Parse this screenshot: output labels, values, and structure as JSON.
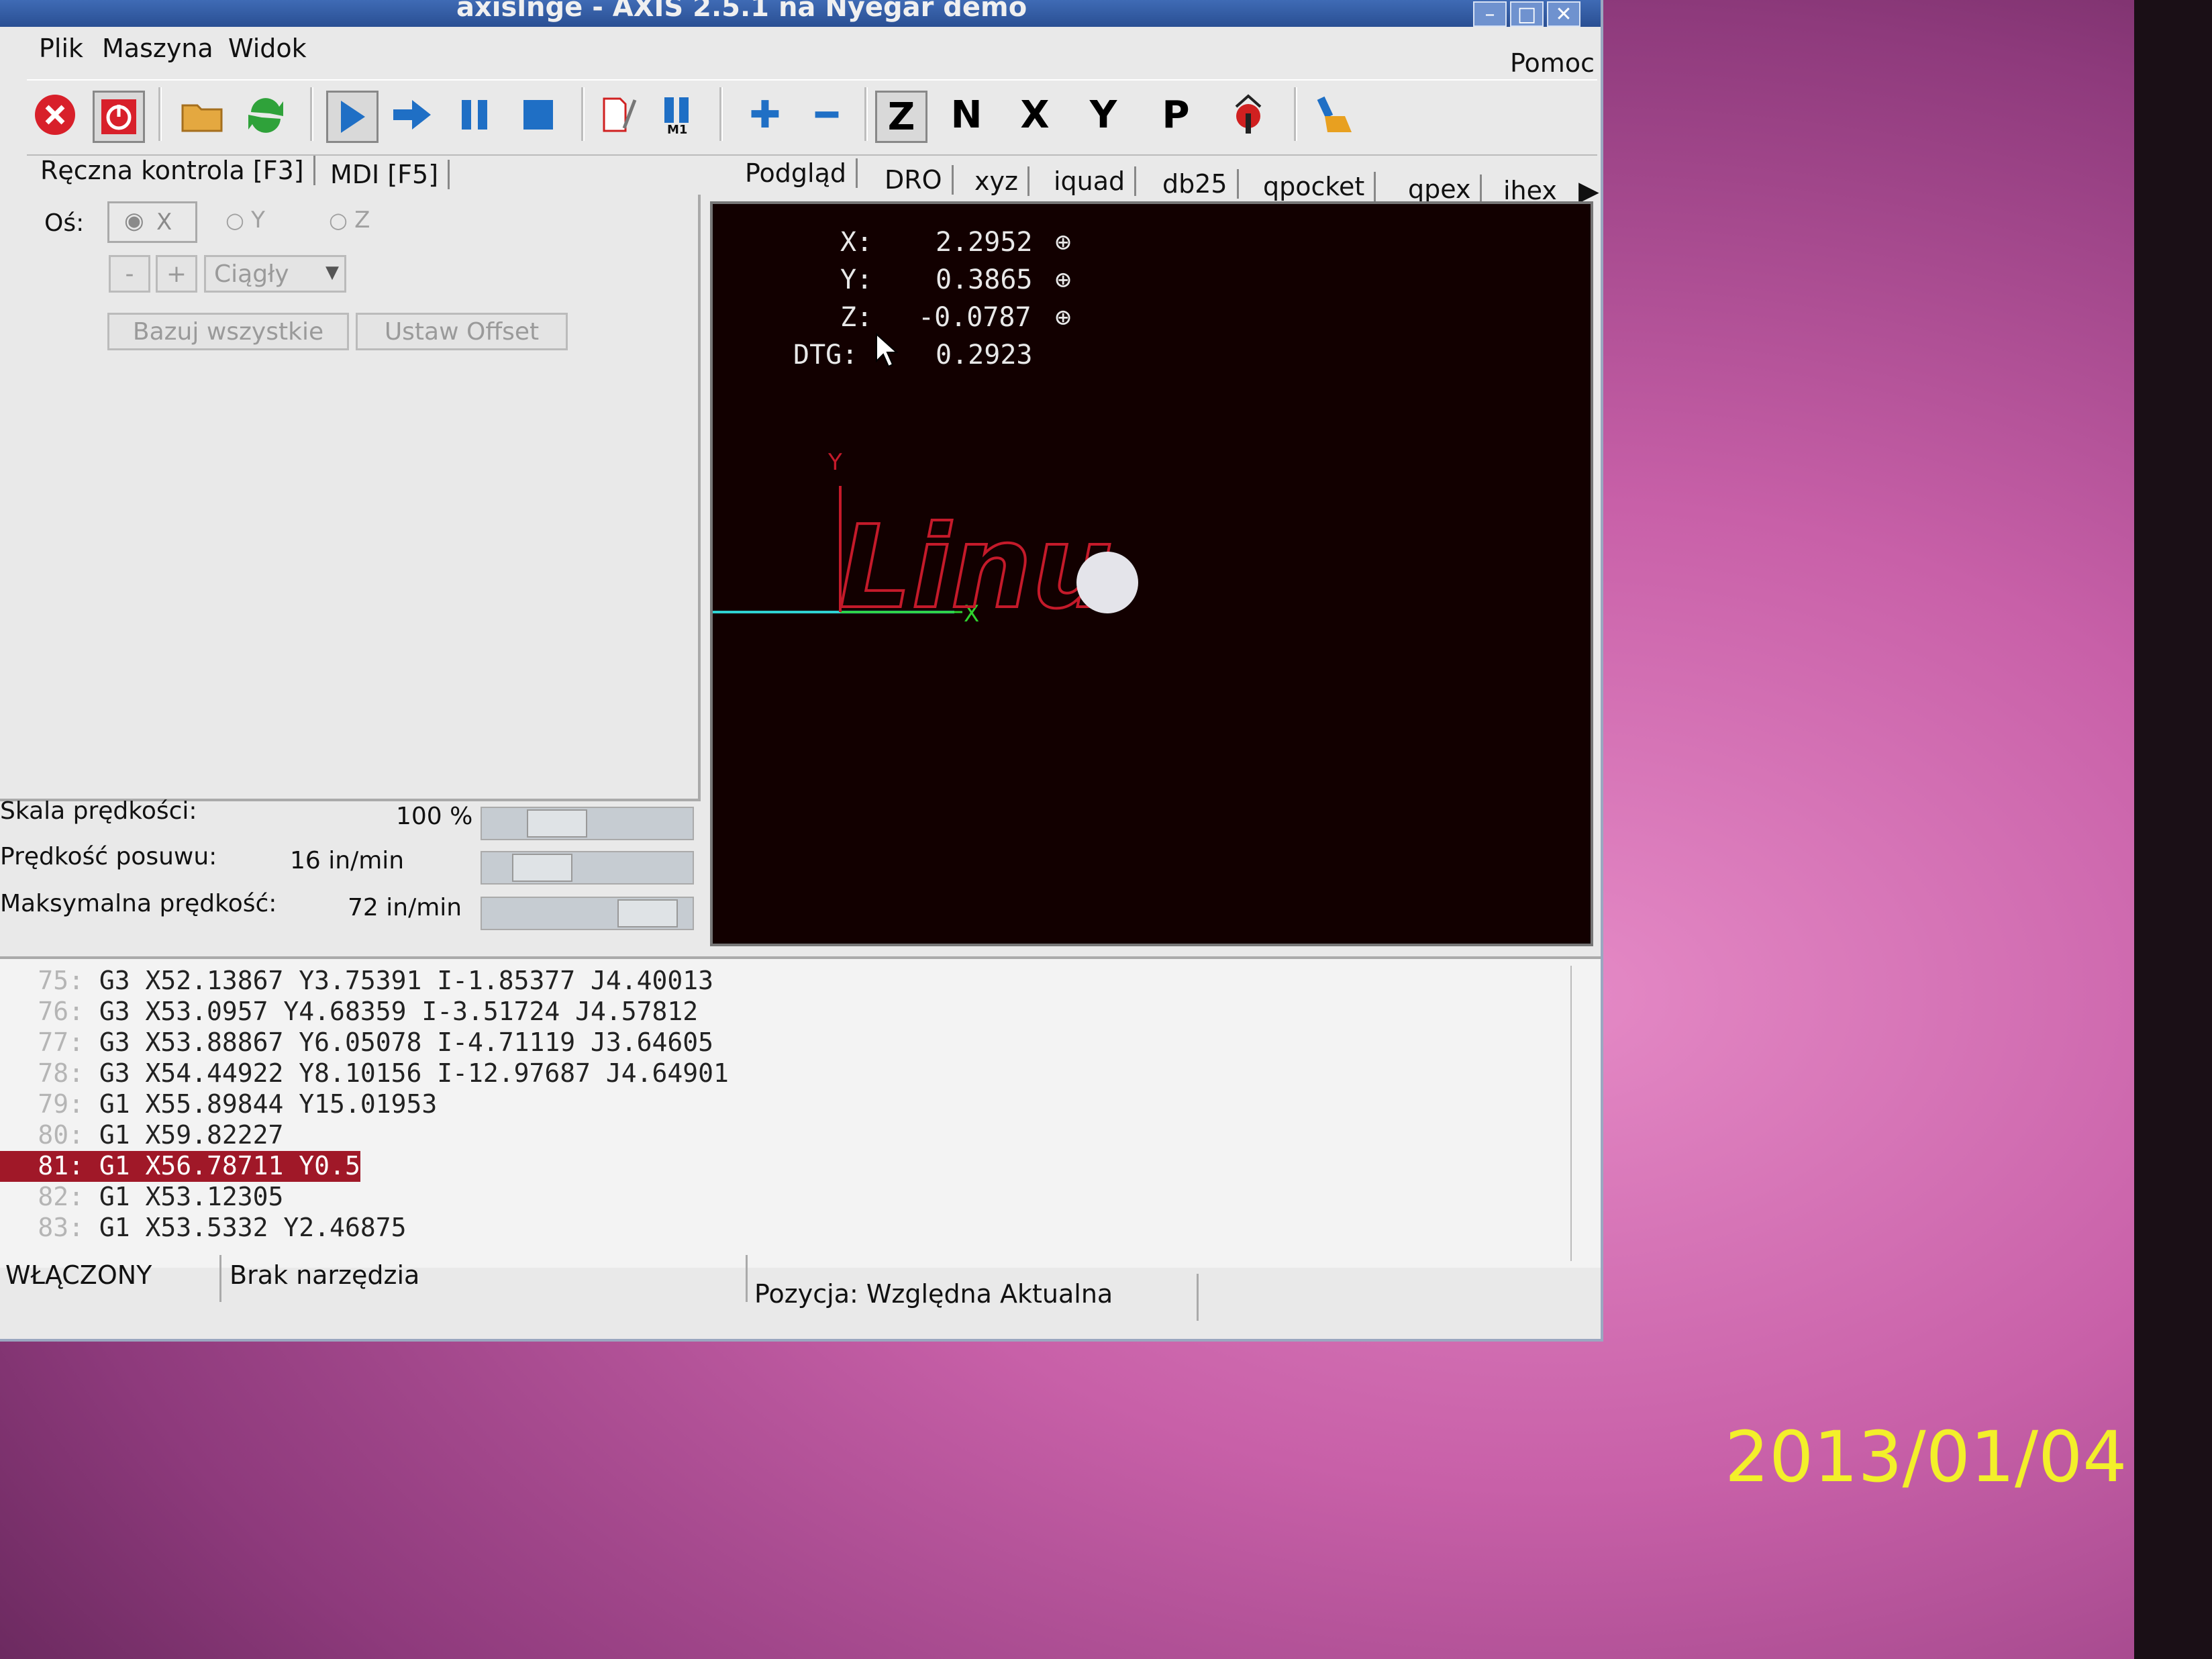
{
  "titlebar": {
    "title": "axislnge - AXIS 2.5.1 na Nyegar demo"
  },
  "menu": {
    "file": "Plik",
    "machine": "Maszyna",
    "view": "Widok",
    "help": "Pomoc"
  },
  "left_tabs": {
    "manual": "Ręczna kontrola [F3]",
    "mdi": "MDI [F5]"
  },
  "right_tabs": [
    "Podgląd",
    "DRO",
    "xyz",
    "iquad",
    "db25",
    "qpocket",
    "qpex",
    "ihex"
  ],
  "manual": {
    "axis_label": "Oś:",
    "axis_x": "X",
    "axis_y": "Y",
    "axis_z": "Z",
    "minus": "-",
    "plus": "+",
    "jog_mode": "Ciągły",
    "home_all": "Bazuj wszystkie",
    "set_offset": "Ustaw Offset"
  },
  "overrides": [
    {
      "label": "Skala prędkości:",
      "value": "100 %",
      "level": 0.3
    },
    {
      "label": "Prędkość posuwu:",
      "value": "16 in/min",
      "level": 0.2
    },
    {
      "label": "Maksymalna prędkość:",
      "value": "72 in/min",
      "level": 0.9
    }
  ],
  "dro": {
    "x_label": "X:",
    "x_value": "2.2952",
    "y_label": "Y:",
    "y_value": "0.3865",
    "z_label": "Z:",
    "z_value": "-0.0787",
    "dtg_label": "DTG:",
    "dtg_value": "0.2923"
  },
  "preview": {
    "axis_y": "Y",
    "axis_x": "X",
    "path_text": "Linu"
  },
  "gcode_lines": [
    {
      "num": "75:",
      "code": "G3 X52.13867 Y3.75391 I-1.85377 J4.40013"
    },
    {
      "num": "76:",
      "code": "G3 X53.0957 Y4.68359 I-3.51724 J4.57812"
    },
    {
      "num": "77:",
      "code": "G3 X53.88867 Y6.05078 I-4.71119 J3.64605"
    },
    {
      "num": "78:",
      "code": "G3 X54.44922 Y8.10156 I-12.97687 J4.64901"
    },
    {
      "num": "79:",
      "code": "G1 X55.89844 Y15.01953"
    },
    {
      "num": "80:",
      "code": "G1 X59.82227"
    },
    {
      "num": "81:",
      "code": "G1 X56.78711 Y0.5"
    },
    {
      "num": "82:",
      "code": "G1 X53.12305"
    },
    {
      "num": "83:",
      "code": "G1 X53.5332 Y2.46875"
    }
  ],
  "status": {
    "machine": "WŁĄCZONY",
    "tool": "Brak narzędzia",
    "position": "Pozycja: Względna Aktualna"
  },
  "photo_date": "2013/01/04"
}
